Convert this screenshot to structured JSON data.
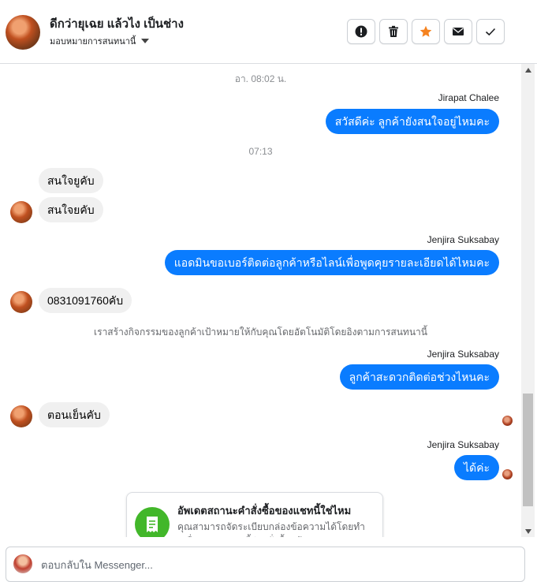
{
  "header": {
    "title": "ดีกว่ายุเฉย แล้วไง เป็นช่าง",
    "assign_label": "มอบหมายการสนทนานี้",
    "actions": [
      {
        "name": "report-button",
        "icon": "exclamation-icon"
      },
      {
        "name": "delete-button",
        "icon": "trash-icon"
      },
      {
        "name": "star-button",
        "icon": "star-icon"
      },
      {
        "name": "mark-unread-button",
        "icon": "envelope-icon"
      },
      {
        "name": "mark-done-button",
        "icon": "check-icon"
      }
    ]
  },
  "messages": {
    "ts1": "อา. 08:02 น.",
    "sender1": "Jirapat Chalee",
    "out1": "สวัสดีค่ะ ลูกค้ายังสนใจอยู่ไหมคะ",
    "ts2": "07:13",
    "in1": "สนใจยูคับ",
    "in2": "สนใจยคับ",
    "sender2": "Jenjira Suksabay",
    "out2": "แอดมินขอเบอร์ติดต่อลูกค้าหรือไลน์เพื่อพูดคุยรายละเอียดได้ไหมคะ",
    "in3": "0831091760คับ",
    "system1": "เราสร้างกิจกรรมของลูกค้าเป้าหมายให้กับคุณโดยอัตโนมัติโดยอิงตามการสนทนานี้",
    "sender3": "Jenjira Suksabay",
    "out3": "ลูกค้าสะดวกติดต่อช่วงไหนคะ",
    "in4": "ตอนเย็นคับ",
    "sender4": "Jenjira Suksabay",
    "out4": "ได้ค่ะ"
  },
  "card": {
    "title": "อัพเดตสถานะคำสั่งซื้อของแชทนี้ใช่ไหม",
    "description": "คุณสามารถจัดระเบียบกล่องข้อความได้โดยทำเครื่องหมายแชทนี้ว่า \"สั่งซื้อแล้ว\""
  },
  "composer": {
    "placeholder": "ตอบกลับใน Messenger..."
  },
  "colors": {
    "outgoing_bubble": "#0a7cff",
    "incoming_bubble": "#f0f0f0",
    "star": "#f5821f",
    "card_icon": "#42b72a"
  }
}
